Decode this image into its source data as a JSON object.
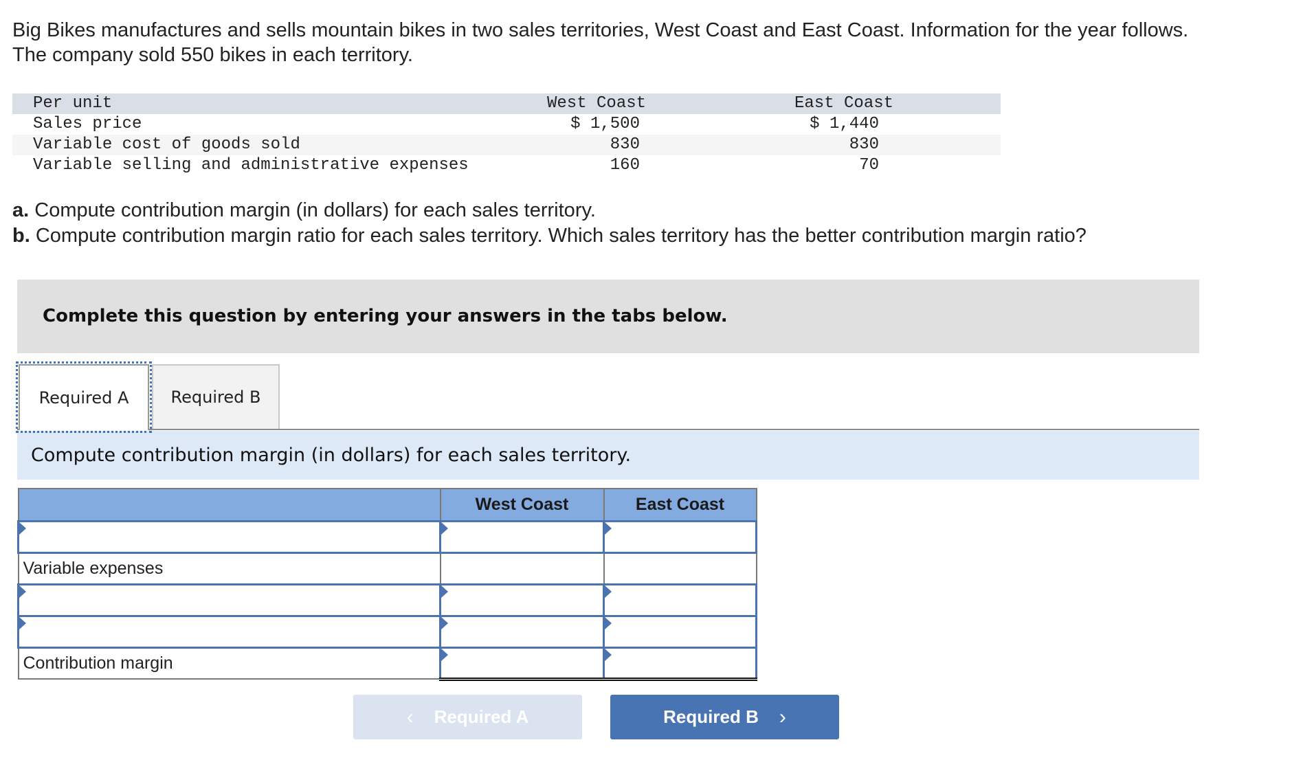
{
  "intro": {
    "line1": "Big Bikes manufactures and sells mountain bikes in two sales territories, West Coast and East Coast. Information for the year follows.",
    "line2": "The company sold 550 bikes in each territory."
  },
  "given_table": {
    "header": {
      "label": "Per unit",
      "west": "West Coast",
      "east": "East Coast"
    },
    "rows": [
      {
        "label": "Sales price",
        "west": "$ 1,500",
        "east": "$ 1,440"
      },
      {
        "label": "Variable cost of goods sold",
        "west": "830",
        "east": "830"
      },
      {
        "label": "Variable selling and administrative expenses",
        "west": "160",
        "east": "70"
      }
    ]
  },
  "questions": {
    "a_prefix": "a.",
    "a_text": " Compute contribution margin (in dollars) for each sales territory.",
    "b_prefix": "b.",
    "b_text": " Compute contribution margin ratio for each sales territory. Which sales territory has the better contribution margin ratio?"
  },
  "notice": "Complete this question by entering your answers in the tabs below.",
  "tabs": [
    {
      "label": "Required A",
      "active": true
    },
    {
      "label": "Required B",
      "active": false
    }
  ],
  "instruction": "Compute contribution margin (in dollars) for each sales territory.",
  "answer_table": {
    "headers": [
      "",
      "West Coast",
      "East Coast"
    ],
    "rows": [
      {
        "label": "",
        "type": "input",
        "west": "",
        "east": ""
      },
      {
        "label": "Variable expenses",
        "type": "static",
        "west": "",
        "east": ""
      },
      {
        "label": "",
        "type": "input",
        "west": "",
        "east": ""
      },
      {
        "label": "",
        "type": "input",
        "west": "",
        "east": ""
      },
      {
        "label": "Contribution margin",
        "type": "total",
        "west": "",
        "east": ""
      }
    ]
  },
  "nav": {
    "prev_label": "Required A",
    "next_label": "Required B",
    "prev_icon": "chevron-left-icon",
    "next_icon": "chevron-right-icon",
    "prev_chevron": "‹",
    "next_chevron": "›"
  },
  "colors": {
    "accent": "#4874b3",
    "header_blue": "#83abdf",
    "instruction_bg": "#dde9f6",
    "disabled_button": "#dae3ef"
  }
}
